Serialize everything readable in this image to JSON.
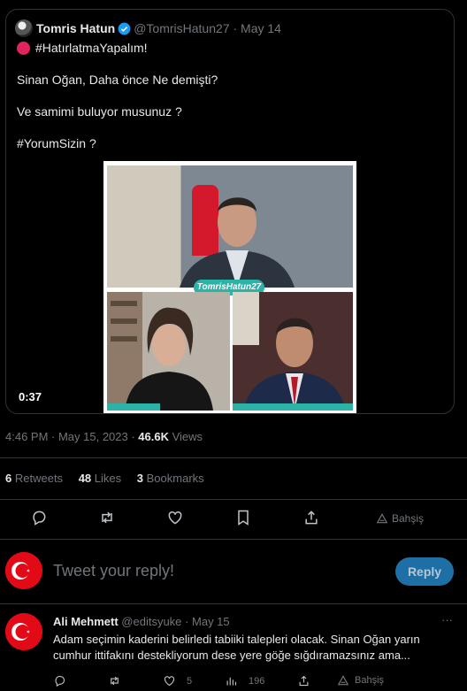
{
  "quoted_tweet": {
    "display_name": "Tomris Hatun",
    "handle": "@TomrisHatun27",
    "date": "May 14",
    "lines": [
      "#HatırlatmaYapalım!",
      "Sinan Oğan, Daha önce Ne demişti?",
      "Ve samimi buluyor musunuz ?",
      "#YorumSizin ?"
    ],
    "video_duration": "0:37",
    "video_watermark": "TomrisHatun27"
  },
  "meta": {
    "time_date": "4:46 PM · May 15, 2023 · ",
    "views_count": "46.6K",
    "views_label": " Views"
  },
  "stats": {
    "retweets_count": "6",
    "retweets_label": "Retweets",
    "likes_count": "48",
    "likes_label": "Likes",
    "bookmarks_count": "3",
    "bookmarks_label": "Bookmarks"
  },
  "actions": {
    "tip_label": "Bahşiş"
  },
  "reply_composer": {
    "placeholder": "Tweet your reply!",
    "button_label": "Reply"
  },
  "reply_tweet": {
    "display_name": "Ali Mehmett",
    "handle": "@editsyuke",
    "date": "May 15",
    "lines": [
      "Adam seçimin kaderini belirledi tabiiki talepleri olacak. Sinan Oğan yarın",
      "cumhur ittifakını destekliyorum dese yere göğe sığdıramazsınız ama..."
    ],
    "like_count": "5",
    "view_count": "196",
    "tip_label": "Bahşiş"
  },
  "colors": {
    "background": "#000000",
    "text": "#e7e9ea",
    "muted": "#71767b",
    "border": "#2f3336",
    "accent": "#1d9bf0",
    "flag_red": "#e30a17"
  }
}
